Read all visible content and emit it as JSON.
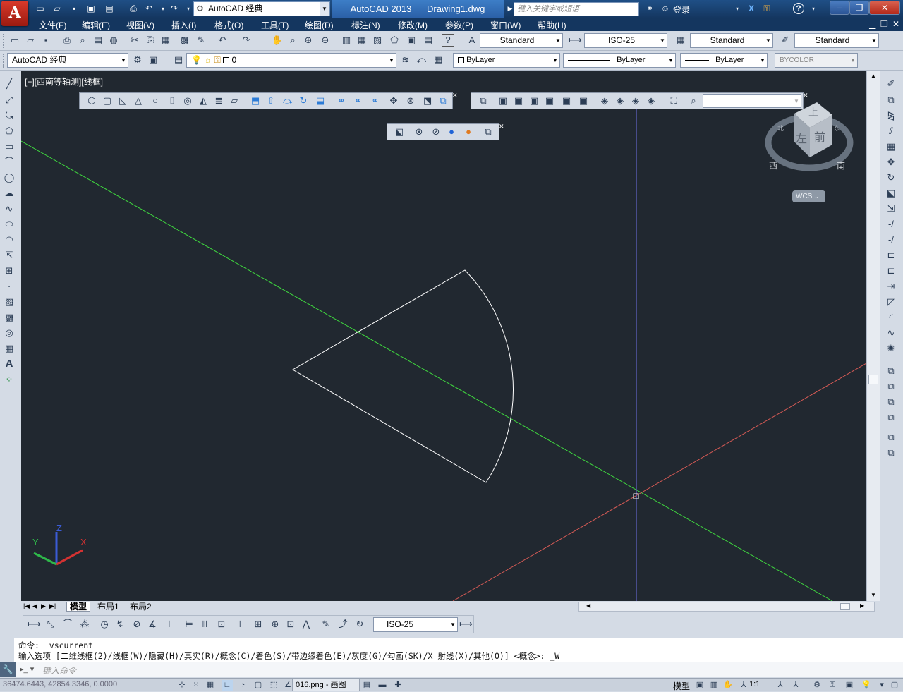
{
  "title_bar": {
    "app_logo": "A",
    "workspace": "AutoCAD 经典",
    "app_name": "AutoCAD 2013",
    "file_name": "Drawing1.dwg",
    "search_placeholder": "键入关键字或短语",
    "login": "登录"
  },
  "menubar": {
    "items": [
      "文件(F)",
      "编辑(E)",
      "视图(V)",
      "插入(I)",
      "格式(O)",
      "工具(T)",
      "绘图(D)",
      "标注(N)",
      "修改(M)",
      "参数(P)",
      "窗口(W)",
      "帮助(H)"
    ]
  },
  "styles_toolbar": {
    "text_style": "Standard",
    "dim_style": "ISO-25",
    "table_style": "Standard",
    "multileader_style": "Standard"
  },
  "layers_toolbar": {
    "workspace": "AutoCAD 经典",
    "current_layer": "0",
    "color": "ByLayer",
    "linetype": "ByLayer",
    "lineweight": "ByLayer",
    "plot_style": "BYCOLOR"
  },
  "viewport": {
    "label": "[−][西南等轴测][线框]",
    "viewcube_top": "上",
    "viewcube_front": "前",
    "viewcube_left": "左",
    "compass_w": "西",
    "compass_s": "南",
    "compass_n": "北",
    "compass_e": "东",
    "wcs_label": "WCS",
    "ucs_x": "X",
    "ucs_y": "Y",
    "ucs_z": "Z"
  },
  "layout_tabs": [
    "模型",
    "布局1",
    "布局2"
  ],
  "dim_toolbar": {
    "dim_style": "ISO-25"
  },
  "command": {
    "line1": "命令: _vscurrent",
    "line2": "输入选项 [二维线框(2)/线框(W)/隐藏(H)/真实(R)/概念(C)/着色(S)/带边缘着色(E)/灰度(G)/勾画(SK)/X 射线(X)/其他(O)] <概念>: _W",
    "input_placeholder": "键入命令"
  },
  "status_bar": {
    "coordinates": "36474.6443, 42854.3346, 0.0000",
    "taskbar_item": "016.png - 画图",
    "model_label": "模型",
    "scale": "1:1"
  },
  "colors": {
    "viewport_bg": "#212830",
    "green_axis": "#3fd63f",
    "red_axis": "#d55a55",
    "blue_axis": "#6f6fe6",
    "shape": "#ffffff"
  }
}
